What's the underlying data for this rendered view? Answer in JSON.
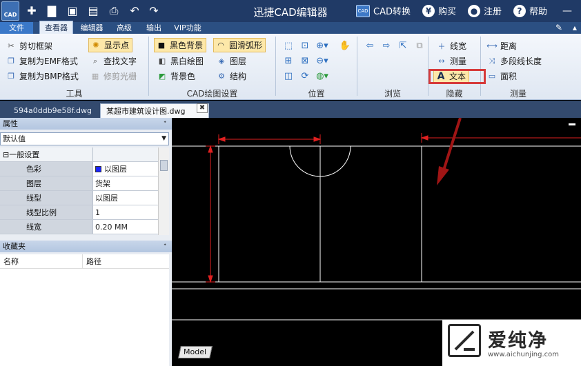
{
  "titlebar": {
    "app_logo_text": "CAD",
    "title": "迅捷CAD编辑器",
    "quick_icons": [
      "new-icon",
      "open-folder-icon",
      "save-icon",
      "save-as-icon",
      "print-icon",
      "undo-icon",
      "redo-icon"
    ],
    "right_items": [
      {
        "icon": "cad-convert-icon",
        "badge": "CAD",
        "label": "CAD转换"
      },
      {
        "icon": "yen-icon",
        "badge": "¥",
        "label": "购买"
      },
      {
        "icon": "user-icon",
        "badge": "●",
        "label": "注册"
      },
      {
        "icon": "help-icon",
        "badge": "?",
        "label": "帮助"
      }
    ]
  },
  "menubar": {
    "tabs": [
      "文件",
      "查看器",
      "编辑器",
      "高级",
      "输出",
      "VIP功能"
    ],
    "active": "查看器"
  },
  "ribbon": {
    "tools": {
      "label": "工具",
      "items": [
        {
          "label": "剪切框架",
          "icon": "scissors-icon"
        },
        {
          "label": "复制为EMF格式",
          "icon": "copy-emf-icon"
        },
        {
          "label": "复制为BMP格式",
          "icon": "copy-bmp-icon"
        },
        {
          "label": "显示点",
          "icon": "show-points-icon",
          "highlighted": true
        },
        {
          "label": "查找文字",
          "icon": "find-text-icon"
        },
        {
          "label": "修剪光栅",
          "icon": "trim-raster-icon",
          "disabled": true
        }
      ]
    },
    "cad_settings": {
      "label": "CAD绘图设置",
      "items": [
        {
          "label": "黑色背景",
          "icon": "black-bg-icon",
          "highlighted": true
        },
        {
          "label": "圆滑弧形",
          "icon": "smooth-arc-icon",
          "highlighted": true
        },
        {
          "label": "黑白绘图",
          "icon": "bw-draw-icon"
        },
        {
          "label": "图层",
          "icon": "layers-icon"
        },
        {
          "label": "背景色",
          "icon": "bg-color-icon"
        },
        {
          "label": "结构",
          "icon": "structure-icon"
        }
      ]
    },
    "position": {
      "label": "位置"
    },
    "browse": {
      "label": "浏览"
    },
    "hide": {
      "label": "隐藏",
      "items": [
        {
          "label": "线宽",
          "icon": "line-width-icon"
        },
        {
          "label": "测量",
          "icon": "measure-icon"
        },
        {
          "label": "文本",
          "icon": "text-a-icon",
          "highlighted": true
        }
      ]
    },
    "measure": {
      "label": "测量",
      "items": [
        {
          "label": "距离",
          "icon": "distance-icon"
        },
        {
          "label": "多段线长度",
          "icon": "polyline-length-icon"
        },
        {
          "label": "面积",
          "icon": "area-icon"
        }
      ]
    }
  },
  "doctabs": {
    "tabs": [
      "594a0ddb9e58f.dwg",
      "某超市建筑设计图.dwg"
    ],
    "active": "某超市建筑设计图.dwg",
    "close_glyph": "✖"
  },
  "properties": {
    "header": "属性",
    "pin": "ᐩ",
    "selector": "默认值",
    "section": "一般设置",
    "rows": [
      {
        "key": "色彩",
        "value": "以图层",
        "swatch": "#1a24ff"
      },
      {
        "key": "图层",
        "value": "货架"
      },
      {
        "key": "线型",
        "value": "以图层"
      },
      {
        "key": "线型比例",
        "value": "1"
      },
      {
        "key": "线宽",
        "value": "0.20 MM"
      }
    ]
  },
  "favorites": {
    "header": "收藏夹",
    "pin": "ᐩ",
    "columns": [
      "名称",
      "路径"
    ]
  },
  "canvas": {
    "model_tab": "Model",
    "colors": {
      "lines": "#ffffff",
      "dimension": "#e02020",
      "arrow": "#a01515"
    }
  },
  "watermark": {
    "text": "爱纯净",
    "url": "www.aichunjing.com"
  }
}
